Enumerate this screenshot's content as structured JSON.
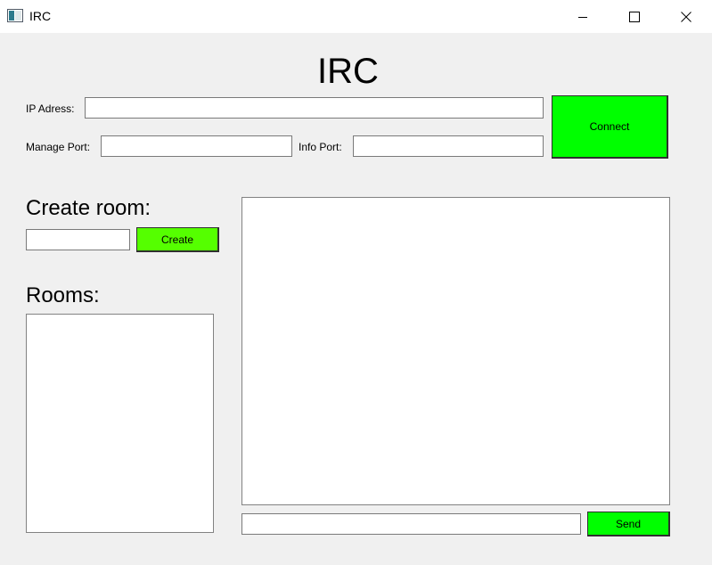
{
  "window": {
    "title": "IRC",
    "app_icon": "window-app-icon",
    "controls": [
      "minimize-icon",
      "maximize-icon",
      "close-icon"
    ]
  },
  "header": {
    "title": "IRC"
  },
  "connection": {
    "ip_label": "IP Adress:",
    "ip_value": "",
    "manage_port_label": "Manage Port:",
    "manage_port_value": "",
    "info_port_label": "Info Port:",
    "info_port_value": "",
    "connect_label": "Connect"
  },
  "create_room": {
    "heading": "Create room:",
    "input_value": "",
    "button_label": "Create"
  },
  "rooms": {
    "heading": "Rooms:",
    "items": []
  },
  "chat": {
    "messages": [],
    "input_value": "",
    "send_label": "Send"
  },
  "colors": {
    "connect_button": "#00ff00",
    "create_button": "#55ff00",
    "send_button": "#00ff00",
    "window_background": "#f0f0f0"
  }
}
